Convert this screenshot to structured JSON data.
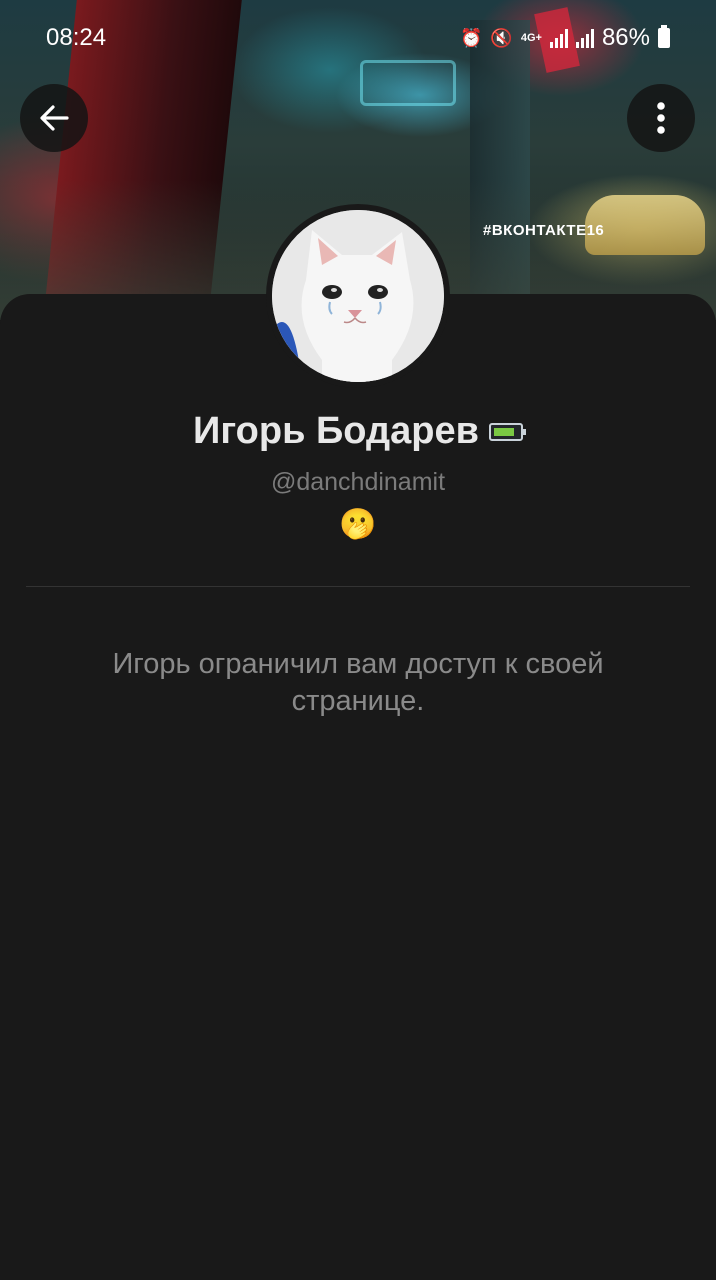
{
  "status_bar": {
    "time": "08:24",
    "network_label": "4G+",
    "battery": "86%"
  },
  "cover": {
    "hashtag": "#ВКОНТАКТЕ16"
  },
  "header": {
    "back_icon": "arrow-left-icon",
    "more_icon": "more-vertical-icon"
  },
  "profile": {
    "name": "Игорь Бодарев",
    "username": "@danchdinamit",
    "status_emoji": "🫢",
    "badge_icon": "battery-badge-icon",
    "avatar": "crying-cat-photo"
  },
  "restriction": {
    "message": "Игорь ограничил вам доступ к своей странице."
  },
  "colors": {
    "background": "#191919",
    "muted_text": "#8a8a8a",
    "name_text": "#e8e8e8"
  }
}
